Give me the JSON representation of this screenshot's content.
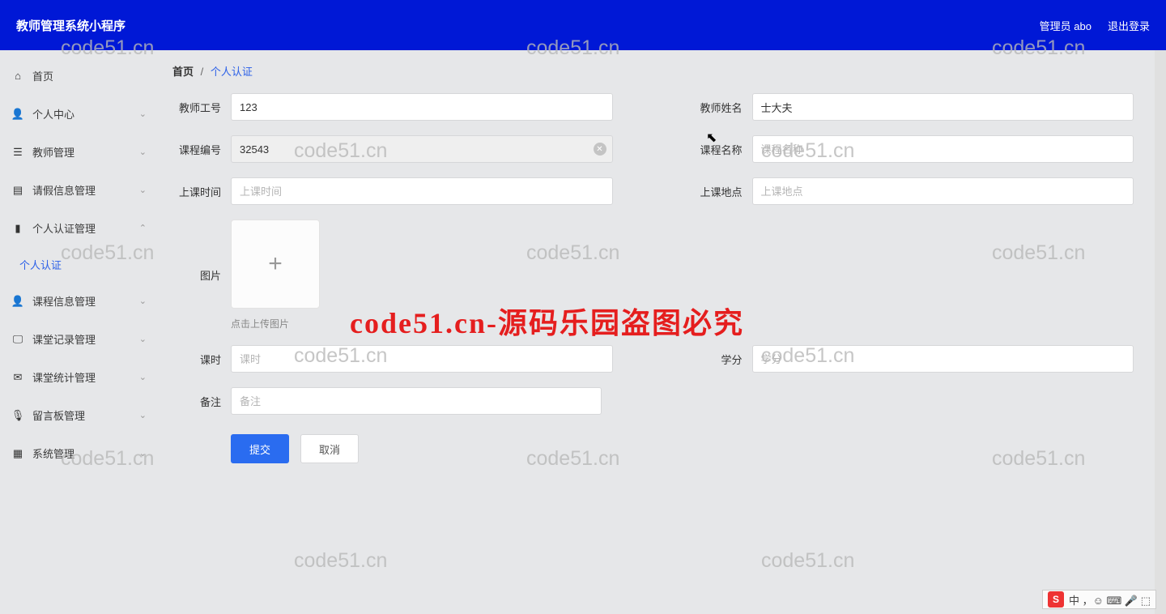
{
  "header": {
    "title": "教师管理系统小程序",
    "admin_label": "管理员 abo",
    "logout_label": "退出登录"
  },
  "sidebar": {
    "items": [
      {
        "label": "首页",
        "icon": "home",
        "chevron": false
      },
      {
        "label": "个人中心",
        "icon": "user",
        "chevron": true
      },
      {
        "label": "教师管理",
        "icon": "list",
        "chevron": true
      },
      {
        "label": "请假信息管理",
        "icon": "doc",
        "chevron": true
      },
      {
        "label": "个人认证管理",
        "icon": "chart",
        "chevron": true,
        "expanded": true,
        "sub": [
          {
            "label": "个人认证"
          }
        ]
      },
      {
        "label": "课程信息管理",
        "icon": "user",
        "chevron": true
      },
      {
        "label": "课堂记录管理",
        "icon": "monitor",
        "chevron": true
      },
      {
        "label": "课堂统计管理",
        "icon": "mail",
        "chevron": true
      },
      {
        "label": "留言板管理",
        "icon": "mic",
        "chevron": true
      },
      {
        "label": "系统管理",
        "icon": "grid",
        "chevron": true
      }
    ]
  },
  "breadcrumb": {
    "home": "首页",
    "sep": "/",
    "current": "个人认证"
  },
  "form": {
    "teacher_no_label": "教师工号",
    "teacher_no_value": "123",
    "teacher_name_label": "教师姓名",
    "teacher_name_value": "士大夫",
    "course_no_label": "课程编号",
    "course_no_value": "32543",
    "course_name_label": "课程名称",
    "course_name_placeholder": "课程名称",
    "class_time_label": "上课时间",
    "class_time_placeholder": "上课时间",
    "class_place_label": "上课地点",
    "class_place_placeholder": "上课地点",
    "image_label": "图片",
    "upload_hint": "点击上传图片",
    "hours_label": "课时",
    "hours_placeholder": "课时",
    "credit_label": "学分",
    "credit_placeholder": "学分",
    "remark_label": "备注",
    "remark_placeholder": "备注",
    "submit_label": "提交",
    "cancel_label": "取消"
  },
  "watermark": {
    "text": "code51.cn",
    "big": "code51.cn-源码乐园盗图必究"
  },
  "ime": {
    "logo": "S",
    "chars": "中 ，☺ ⌨ 🎤 ⬚"
  }
}
